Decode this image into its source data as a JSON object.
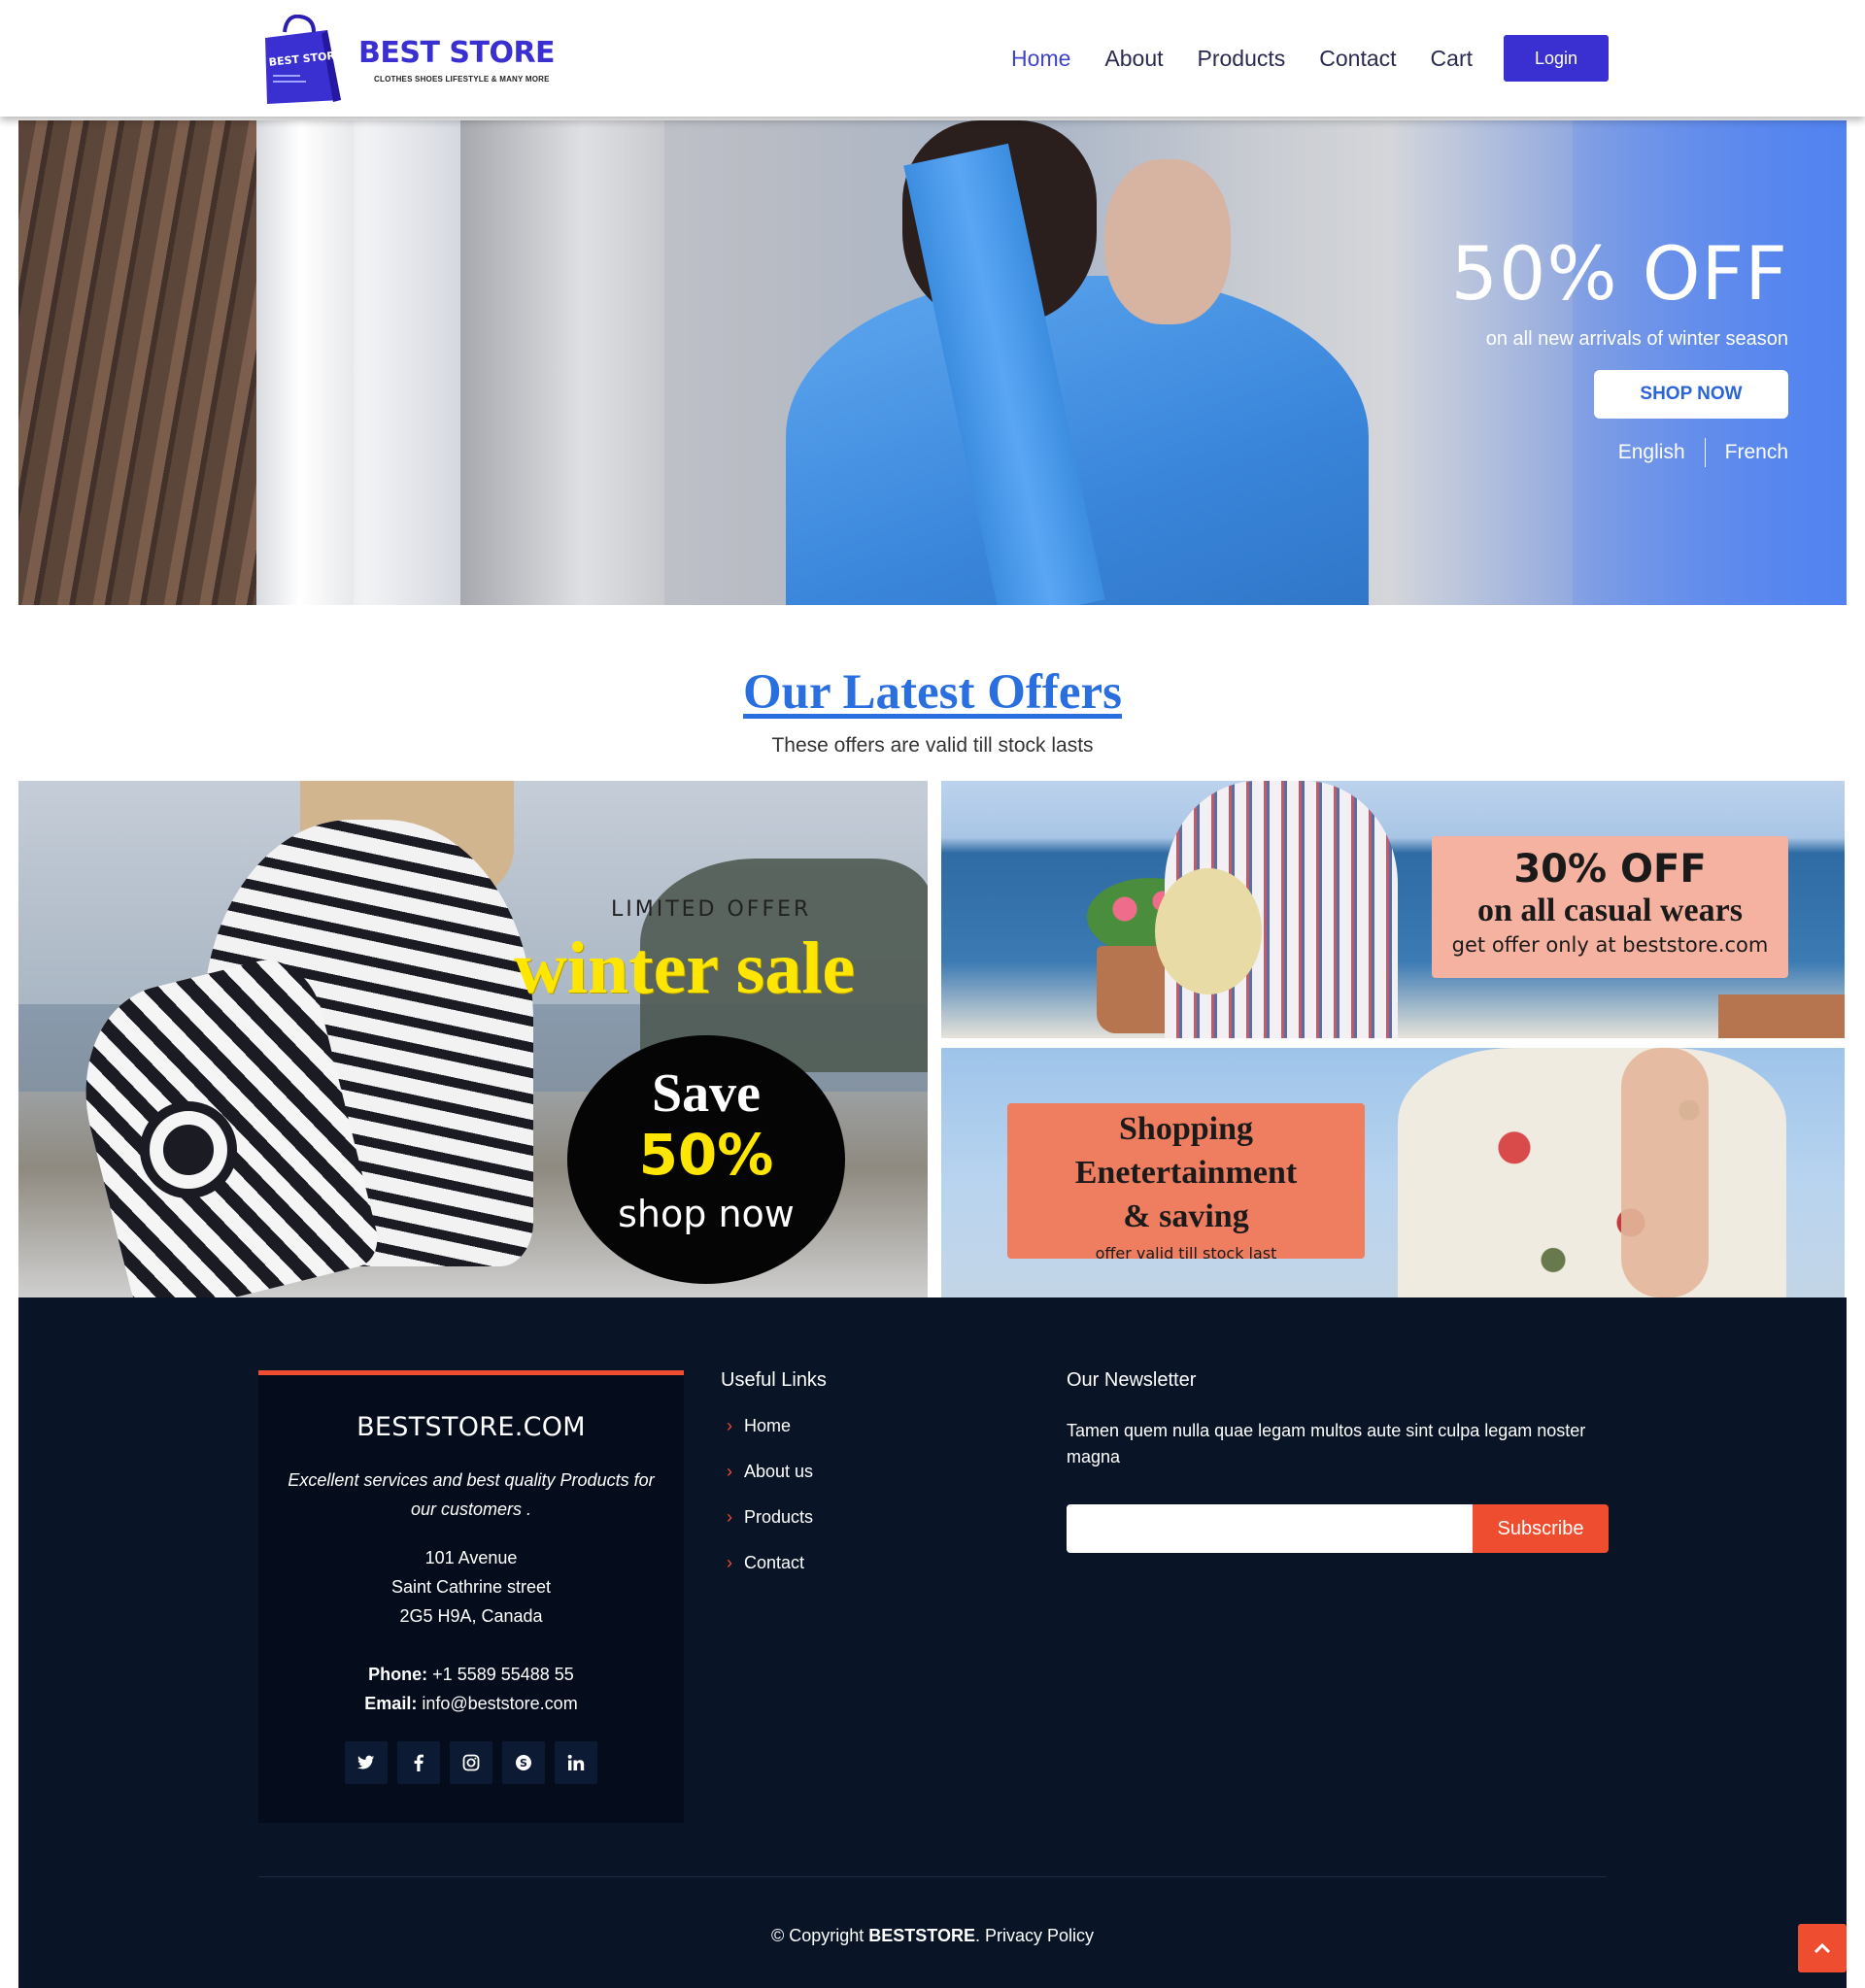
{
  "header": {
    "logo_title": "BEST STORE",
    "logo_tagline": "CLOTHES  SHOES  LIFESTYLE  & MANY MORE",
    "logo_bag_text": "BEST STORE",
    "nav": [
      {
        "label": "Home",
        "active": true
      },
      {
        "label": "About"
      },
      {
        "label": "Products"
      },
      {
        "label": "Contact"
      },
      {
        "label": "Cart"
      }
    ],
    "login_label": "Login",
    "accent_color": "#3a2fd0"
  },
  "hero": {
    "title": "50% OFF",
    "subtitle": "on all new arrivals of winter season",
    "cta_label": "SHOP NOW",
    "languages": [
      "English",
      "French"
    ]
  },
  "offers": {
    "title": "Our Latest Offers",
    "subtitle": "These offers are valid till stock lasts",
    "left": {
      "kicker": "LIMITED OFFER",
      "headline": "winter sale",
      "badge_line1": "Save",
      "badge_line2": "50%",
      "badge_line3": "shop now"
    },
    "top_right": {
      "line1": "30% OFF",
      "line2": "on all casual wears",
      "line3": "get offer only at beststore.com"
    },
    "bottom_right": {
      "line1": "Shopping",
      "line2": "Enetertainment",
      "line3": "& saving",
      "line4": "offer valid till stock last"
    }
  },
  "footer": {
    "brand": "BESTSTORE.COM",
    "description": "Excellent services and best quality Products for our customers .",
    "address": [
      "101 Avenue",
      "Saint Cathrine street",
      "2G5 H9A, Canada"
    ],
    "phone_label": "Phone:",
    "phone": "+1 5589 55488 55",
    "email_label": "Email:",
    "email": "info@beststore.com",
    "social": [
      "twitter-icon",
      "facebook-icon",
      "instagram-icon",
      "skype-icon",
      "linkedin-icon"
    ],
    "links_title": "Useful Links",
    "links": [
      "Home",
      "About us",
      "Products",
      "Contact"
    ],
    "newsletter_title": "Our Newsletter",
    "newsletter_text": "Tamen quem nulla quae legam multos aute sint culpa legam noster magna",
    "newsletter_input_value": "",
    "subscribe_label": "Subscribe",
    "copyright_prefix": "© Copyright",
    "copyright_brand": "BESTSTORE",
    "copyright_suffix": ". Privacy Policy",
    "accent_color": "#ef4d2f"
  }
}
